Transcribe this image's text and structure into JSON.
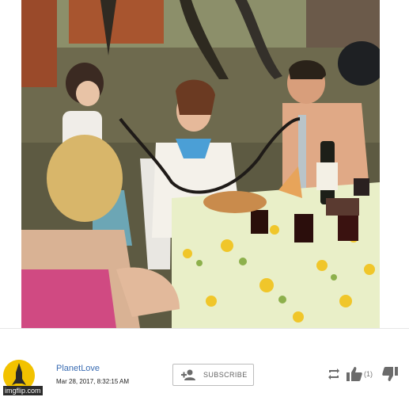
{
  "post": {
    "username": "PlanetLove",
    "timestamp": "Mar 28, 2017, 8:32:15 AM",
    "watermark": "imgflip.com"
  },
  "actions": {
    "subscribe_label": "SUBSCRIBE",
    "like_count": "(1)"
  },
  "icons": {
    "subscribe": "add-user-icon",
    "share": "repost-icon",
    "like": "thumbs-up-icon",
    "dislike": "thumbs-down-icon"
  },
  "colors": {
    "username": "#3b6db3",
    "avatar": "#f2c200",
    "icon": "#6b6b6b"
  }
}
